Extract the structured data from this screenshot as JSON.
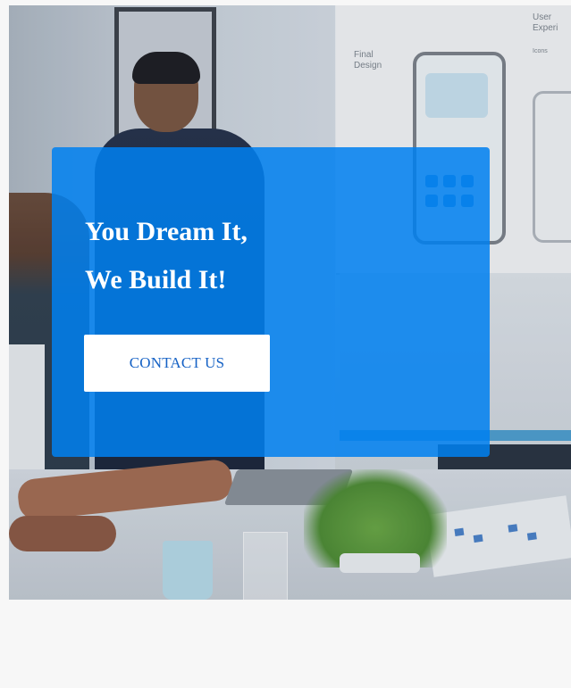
{
  "hero": {
    "headline_line1": "You Dream It,",
    "headline_line2": "We Build It!",
    "cta_label": "CONTACT US",
    "overlay_color": "#0080f0",
    "cta_text_color": "#1662c5"
  },
  "background_board": {
    "final_design_label": "Final\nDesign",
    "user_experience_label": "User\nExperi",
    "icons_label": "Icons"
  }
}
